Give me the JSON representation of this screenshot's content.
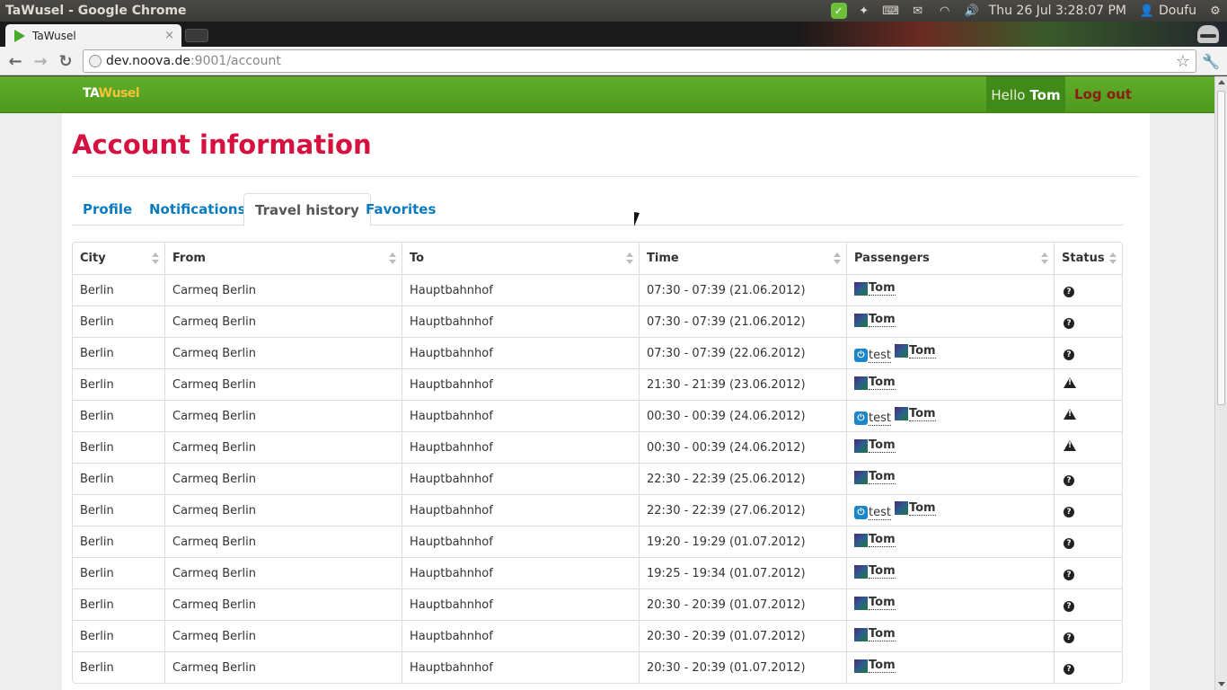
{
  "os_panel": {
    "window_title": "TaWusel - Google Chrome",
    "clock": "Thu 26 Jul  3:28:07 PM",
    "user": "Doufu",
    "tray_icons": [
      "ok-check-icon",
      "dropbox-icon",
      "keyboard-icon",
      "mail-icon",
      "wifi-icon",
      "volume-icon",
      "user-icon",
      "power-gear-icon"
    ]
  },
  "browser": {
    "tab_title": "TaWusel",
    "url_host": "dev.noova.de",
    "url_path": ":9001/account"
  },
  "app": {
    "brand_ta": "TA",
    "brand_wusel": "Wusel",
    "hello_label": "Hello",
    "user_name": "Tom",
    "logout_label": "Log out",
    "page_title": "Account information",
    "tabs": [
      {
        "label": "Profile",
        "active": false
      },
      {
        "label": "Notifications",
        "active": false
      },
      {
        "label": "Travel history",
        "active": true
      },
      {
        "label": "Favorites",
        "active": false
      }
    ],
    "columns": [
      "City",
      "From",
      "To",
      "Time",
      "Passengers",
      "Status"
    ],
    "rows": [
      {
        "city": "Berlin",
        "from": "Carmeq Berlin",
        "to": "Hauptbahnhof",
        "time": "07:30 - 07:39 (21.06.2012)",
        "test": false,
        "status": "unknown"
      },
      {
        "city": "Berlin",
        "from": "Carmeq Berlin",
        "to": "Hauptbahnhof",
        "time": "07:30 - 07:39 (21.06.2012)",
        "test": false,
        "status": "unknown"
      },
      {
        "city": "Berlin",
        "from": "Carmeq Berlin",
        "to": "Hauptbahnhof",
        "time": "07:30 - 07:39 (22.06.2012)",
        "test": true,
        "status": "unknown"
      },
      {
        "city": "Berlin",
        "from": "Carmeq Berlin",
        "to": "Hauptbahnhof",
        "time": "21:30 - 21:39 (23.06.2012)",
        "test": false,
        "status": "warning"
      },
      {
        "city": "Berlin",
        "from": "Carmeq Berlin",
        "to": "Hauptbahnhof",
        "time": "00:30 - 00:39 (24.06.2012)",
        "test": true,
        "status": "warning"
      },
      {
        "city": "Berlin",
        "from": "Carmeq Berlin",
        "to": "Hauptbahnhof",
        "time": "00:30 - 00:39 (24.06.2012)",
        "test": false,
        "status": "warning"
      },
      {
        "city": "Berlin",
        "from": "Carmeq Berlin",
        "to": "Hauptbahnhof",
        "time": "22:30 - 22:39 (25.06.2012)",
        "test": false,
        "status": "unknown"
      },
      {
        "city": "Berlin",
        "from": "Carmeq Berlin",
        "to": "Hauptbahnhof",
        "time": "22:30 - 22:39 (27.06.2012)",
        "test": true,
        "status": "unknown"
      },
      {
        "city": "Berlin",
        "from": "Carmeq Berlin",
        "to": "Hauptbahnhof",
        "time": "19:20 - 19:29 (01.07.2012)",
        "test": false,
        "status": "unknown"
      },
      {
        "city": "Berlin",
        "from": "Carmeq Berlin",
        "to": "Hauptbahnhof",
        "time": "19:25 - 19:34 (01.07.2012)",
        "test": false,
        "status": "unknown"
      },
      {
        "city": "Berlin",
        "from": "Carmeq Berlin",
        "to": "Hauptbahnhof",
        "time": "20:30 - 20:39 (01.07.2012)",
        "test": false,
        "status": "unknown"
      },
      {
        "city": "Berlin",
        "from": "Carmeq Berlin",
        "to": "Hauptbahnhof",
        "time": "20:30 - 20:39 (01.07.2012)",
        "test": false,
        "status": "unknown"
      },
      {
        "city": "Berlin",
        "from": "Carmeq Berlin",
        "to": "Hauptbahnhof",
        "time": "20:30 - 20:39 (01.07.2012)",
        "test": false,
        "status": "unknown"
      }
    ],
    "test_passenger": "test",
    "main_passenger": "Tom"
  },
  "colors": {
    "nav_green": "#5aa826",
    "title_red": "#d6103f",
    "link_blue": "#0b7bbf",
    "logout_red": "#8b1c10"
  }
}
